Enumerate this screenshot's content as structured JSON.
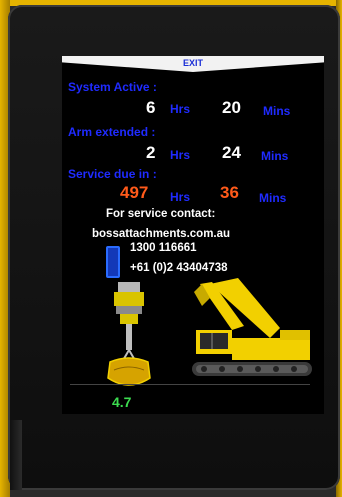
{
  "screen": {
    "exit_label": "EXIT",
    "system_active": {
      "label": "System Active :",
      "hours": "6",
      "hours_unit": "Hrs",
      "mins": "20",
      "mins_unit": "Mins"
    },
    "arm_extended": {
      "label": "Arm extended :",
      "hours": "2",
      "hours_unit": "Hrs",
      "mins": "24",
      "mins_unit": "Mins"
    },
    "service_due": {
      "label": "Service due in :",
      "hours": "497",
      "hours_unit": "Hrs",
      "mins": "36",
      "mins_unit": "Mins"
    },
    "contact": {
      "heading": "For service contact:",
      "website": "bossattachments.com.au",
      "phone1": "1300 116661",
      "phone2": "+61 (0)2 43404738"
    },
    "reading": "4.7"
  },
  "colors": {
    "label_blue": "#1f2bff",
    "value_white": "#ffffff",
    "service_orange": "#ff5a1a",
    "reading_green": "#3cdc50",
    "excavator_yellow": "#f2d000"
  }
}
